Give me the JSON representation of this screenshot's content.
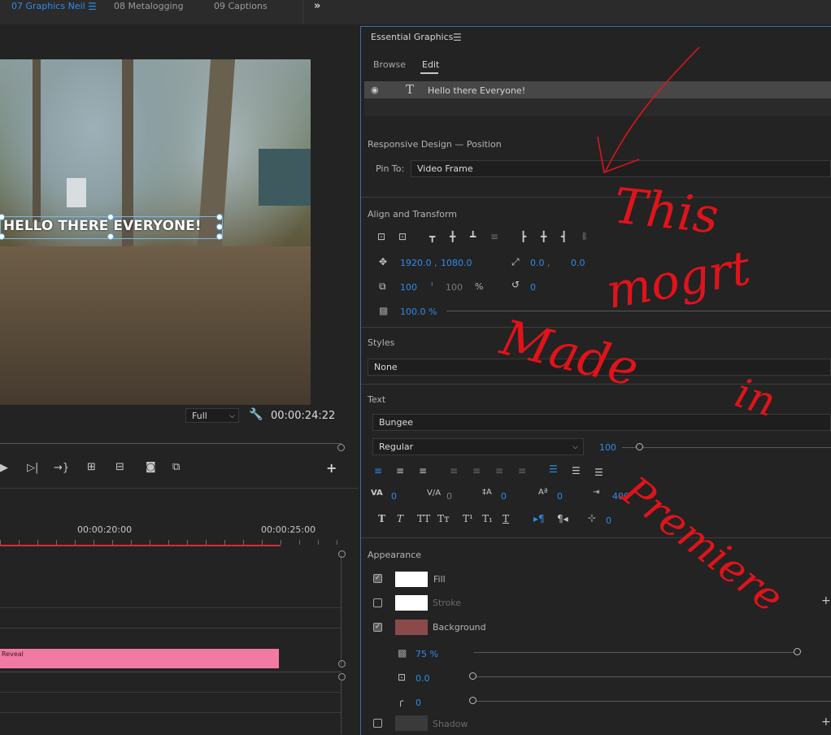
{
  "tabs": [
    {
      "label": "07 Graphics Neil",
      "active": true
    },
    {
      "label": "08 Metalogging",
      "active": false
    },
    {
      "label": "09 Captions",
      "active": false
    }
  ],
  "tab_menu_icon": "hamburger-icon",
  "tab_overflow_icon": "chevron-double-right-icon",
  "program_monitor": {
    "title_text": "HELLO THERE EVERYONE!",
    "resolution": "Full",
    "timecode": "00:00:24:22"
  },
  "timeline": {
    "time_labels": [
      "00:00:20:00",
      "00:00:25:00"
    ],
    "clip_label": "Reveal",
    "clip_color": "#f07aa4"
  },
  "essential_graphics": {
    "title": "Essential Graphics",
    "tabs": [
      "Browse",
      "Edit"
    ],
    "layer_name": "Hello there Everyone!",
    "responsive": {
      "section": "Responsive Design — Position",
      "pin_label": "Pin To:",
      "pin_value": "Video Frame"
    },
    "align": {
      "section": "Align and Transform",
      "pos_x": "1920.0 ,",
      "pos_y": "1080.0",
      "anchor_x": "0.0 ,",
      "anchor_y": "0.0",
      "scale": "100",
      "scale_h": "100",
      "scale_unit": "%",
      "rotation": "0",
      "opacity": "100.0 %"
    },
    "styles": {
      "section": "Styles",
      "value": "None"
    },
    "text": {
      "section": "Text",
      "font": "Bungee",
      "weight": "Regular",
      "size": "100",
      "kerning": "0",
      "tracking": "0",
      "leading": "0",
      "baseline": "0",
      "tsume": "400",
      "tab_width": "0"
    },
    "appearance": {
      "section": "Appearance",
      "fill": {
        "label": "Fill",
        "checked": true,
        "color": "#ffffff"
      },
      "stroke": {
        "label": "Stroke",
        "checked": false,
        "color": "#ffffff"
      },
      "background": {
        "label": "Background",
        "checked": true,
        "color": "#8a4a4a"
      },
      "bg_opacity": "75 %",
      "bg_size": "0.0",
      "bg_corner": "0",
      "shadow": {
        "label": "Shadow",
        "checked": false
      }
    }
  },
  "annotation": {
    "line1": "This",
    "line2": "mogrt",
    "line3": "Made",
    "line4": "in",
    "line5": "Premiere",
    "color": "#e0131a"
  },
  "accent_color": "#2d8ceb"
}
